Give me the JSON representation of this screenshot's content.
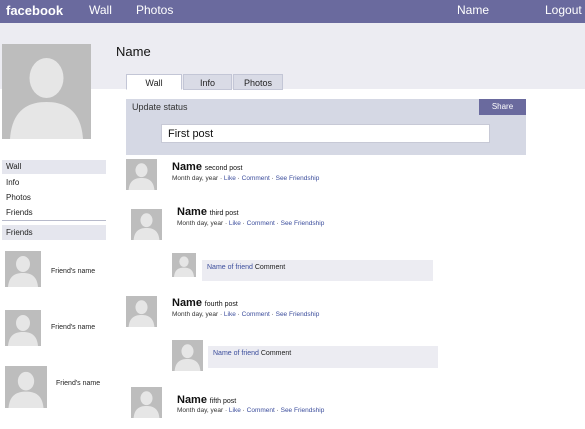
{
  "topbar": {
    "logo": "facebook",
    "nav": [
      "Wall",
      "Photos"
    ],
    "right": [
      "Name",
      "Logout"
    ]
  },
  "profile": {
    "name": "Name"
  },
  "tabs": [
    "Wall",
    "Info",
    "Photos"
  ],
  "status": {
    "label": "Update status",
    "share": "Share",
    "value": "First post"
  },
  "sidebar": {
    "items": [
      "Wall",
      "Info",
      "Photos",
      "Friends"
    ],
    "friends_header": "Friends",
    "friends": [
      "Friend's name",
      "Friend's name",
      "Friend's name"
    ]
  },
  "posts": [
    {
      "name": "Name",
      "title": "second post",
      "date": "Month day, year",
      "like": "Like",
      "comment": "Comment",
      "friendship": "See Friendship"
    },
    {
      "name": "Name",
      "title": "third post",
      "date": "Month day, year",
      "like": "Like",
      "comment": "Comment",
      "friendship": "See Friendship"
    },
    {
      "name": "Name",
      "title": "fourth post",
      "date": "Month day, year",
      "like": "Like",
      "comment": "Comment",
      "friendship": "See Friendship"
    },
    {
      "name": "Name",
      "title": "fifth post",
      "date": "Month day, year",
      "like": "Like",
      "comment": "Comment",
      "friendship": "See Friendship"
    }
  ],
  "comments": [
    {
      "friend": "Name of friend",
      "text": "Comment"
    },
    {
      "friend": "Name of friend",
      "text": "Comment"
    }
  ],
  "colors": {
    "brand": "#6a6a9e",
    "panel": "#d5d8e4",
    "link": "#3b4d9c"
  }
}
